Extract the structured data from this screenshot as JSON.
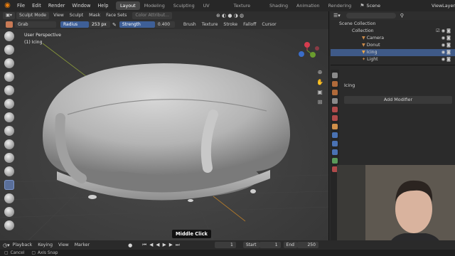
{
  "app": {
    "logo": "blender-logo"
  },
  "menu": [
    "File",
    "Edit",
    "Render",
    "Window",
    "Help"
  ],
  "workspaces": [
    "Layout",
    "Modeling",
    "Sculpting",
    "UV Editing",
    "Texture Paint",
    "Shading",
    "Animation",
    "Rendering"
  ],
  "active_workspace": "Layout",
  "scene": {
    "label": "Scene",
    "view_layer": "ViewLayer"
  },
  "viewport_header": {
    "mode": "Sculpt Mode",
    "items": [
      "View",
      "Sculpt",
      "Mask",
      "Face Sets"
    ],
    "color_attr": "Color Attribut...",
    "right_items": [
      "Brush",
      "Texture",
      "Stroke",
      "Falloff",
      "Cursor"
    ]
  },
  "tool_header": {
    "brush": "Grab",
    "radius_label": "Radius",
    "radius_value": "253 px",
    "strength_label": "Strength",
    "strength_value": "0.400"
  },
  "overlay": {
    "perspective": "User Perspective",
    "object": "(1) Icing"
  },
  "outliner": {
    "scene_collection": "Scene Collection",
    "collection": "Collection",
    "items": [
      {
        "name": "Camera",
        "icon": "camera-icon",
        "selected": false
      },
      {
        "name": "Donut",
        "icon": "mesh-icon",
        "selected": false
      },
      {
        "name": "Icing",
        "icon": "mesh-icon",
        "selected": true
      },
      {
        "name": "Light",
        "icon": "light-icon",
        "selected": false
      }
    ]
  },
  "properties": {
    "object_name": "Icing",
    "add_modifier": "Add Modifier"
  },
  "timeline": {
    "items": [
      "Playback",
      "Keying",
      "View",
      "Marker"
    ],
    "current_frame": "1",
    "start_label": "Start",
    "start": "1",
    "end_label": "End",
    "end": "250"
  },
  "tooltip": "Middle Click",
  "status": {
    "cancel": "Cancel",
    "axis_snap": "Axis Snap"
  },
  "colors": {
    "accent": "#4772b3",
    "selected_row": "#3f5a88",
    "blender_orange": "#e87d0d"
  }
}
